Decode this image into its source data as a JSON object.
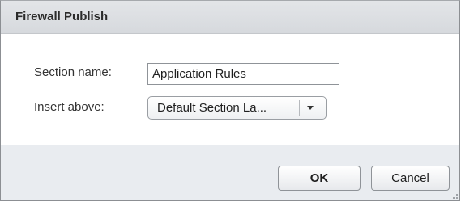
{
  "dialog": {
    "title": "Firewall Publish"
  },
  "form": {
    "section_name_label": "Section name:",
    "section_name_value": "Application Rules",
    "insert_above_label": "Insert above:",
    "insert_above_value": "Default Section La..."
  },
  "buttons": {
    "ok_label": "OK",
    "cancel_label": "Cancel"
  },
  "icons": {
    "dropdown": "chevron-down-icon",
    "resize": "resize-grip-icon"
  }
}
